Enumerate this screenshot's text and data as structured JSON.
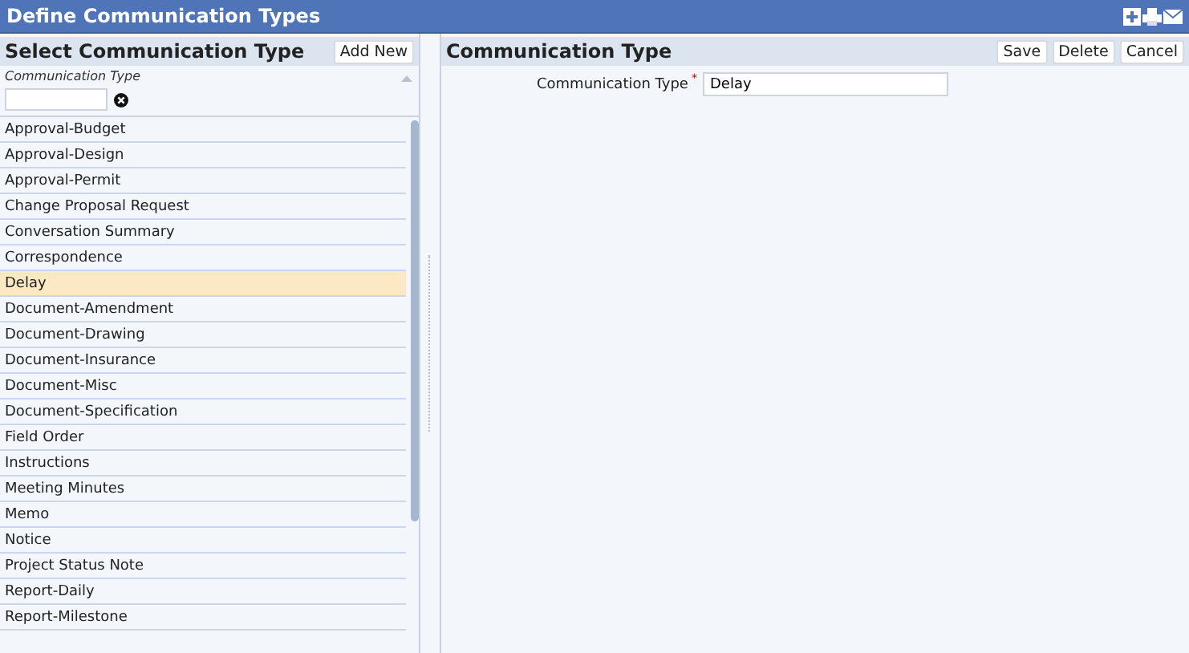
{
  "window": {
    "title": "Define Communication Types"
  },
  "left_panel": {
    "title": "Select Communication Type",
    "add_button": "Add New",
    "filter": {
      "label": "Communication Type"
    },
    "items": [
      {
        "label": "Approval-Budget",
        "selected": false
      },
      {
        "label": "Approval-Design",
        "selected": false
      },
      {
        "label": "Approval-Permit",
        "selected": false
      },
      {
        "label": "Change Proposal Request",
        "selected": false
      },
      {
        "label": "Conversation Summary",
        "selected": false
      },
      {
        "label": "Correspondence",
        "selected": false
      },
      {
        "label": "Delay",
        "selected": true
      },
      {
        "label": "Document-Amendment",
        "selected": false
      },
      {
        "label": "Document-Drawing",
        "selected": false
      },
      {
        "label": "Document-Insurance",
        "selected": false
      },
      {
        "label": "Document-Misc",
        "selected": false
      },
      {
        "label": "Document-Specification",
        "selected": false
      },
      {
        "label": "Field Order",
        "selected": false
      },
      {
        "label": "Instructions",
        "selected": false
      },
      {
        "label": "Meeting Minutes",
        "selected": false
      },
      {
        "label": "Memo",
        "selected": false
      },
      {
        "label": "Notice",
        "selected": false
      },
      {
        "label": "Project Status Note",
        "selected": false
      },
      {
        "label": "Report-Daily",
        "selected": false
      },
      {
        "label": "Report-Milestone",
        "selected": false
      }
    ]
  },
  "right_panel": {
    "title": "Communication Type",
    "buttons": [
      "Save",
      "Delete",
      "Cancel"
    ],
    "field": {
      "label": "Communication Type",
      "required_mark": "*",
      "value": "Delay"
    }
  }
}
